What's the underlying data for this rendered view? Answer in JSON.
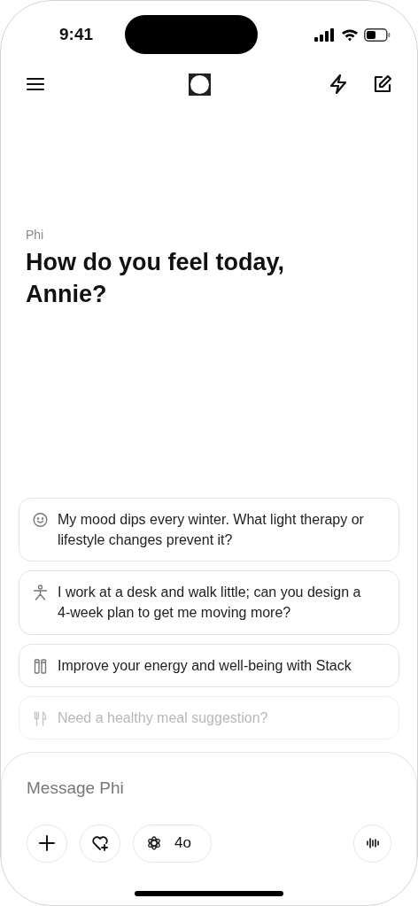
{
  "status_bar": {
    "time": "9:41"
  },
  "greeting": {
    "assistant": "Phi",
    "title": "How do you feel today, Annie?"
  },
  "suggestions": [
    {
      "kind": "mood",
      "text": "My mood dips every winter. What light therapy or lifestyle changes prevent it?",
      "dimmed": false
    },
    {
      "kind": "activity",
      "text": "I work at a desk and walk little; can you design a 4-week plan to get me moving more?",
      "dimmed": false
    },
    {
      "kind": "stack",
      "text": "Improve your energy and well-being with Stack",
      "dimmed": false
    },
    {
      "kind": "meal",
      "text": "Need a healthy meal suggestion?",
      "dimmed": true
    }
  ],
  "composer": {
    "placeholder": "Message Phi",
    "model": "4o"
  }
}
